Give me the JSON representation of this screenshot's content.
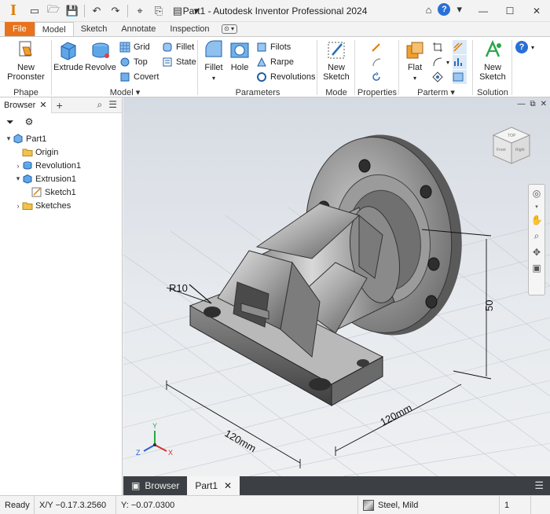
{
  "titlebar": {
    "title": "Part1 - Autodesk Inventor Professional 2024",
    "qat_icons": [
      "new-file-icon",
      "open-icon",
      "save-icon",
      "undo-icon",
      "redo-icon",
      "select-icon",
      "share-icon",
      "measure-icon"
    ]
  },
  "tabs": [
    "File",
    "Model",
    "Sketch",
    "Annotate",
    "Inspection"
  ],
  "ribbon": {
    "phape": {
      "new_label": "New\nProonster",
      "group": "Phape"
    },
    "model": {
      "extrude": "Extrude",
      "revolve": "Revolve",
      "grid": "Grid",
      "top": "Top",
      "covert": "Covert",
      "fillet": "Fillet",
      "state": "State",
      "group": "Model"
    },
    "parameters": {
      "fillet": "Fillet",
      "hole": "Hole",
      "filots": "Filots",
      "rarpe": "Rarpe",
      "revolutions": "Revolutions",
      "group": "Parameters"
    },
    "mode": {
      "new_sketch": "New\nSketch",
      "group": "Mode"
    },
    "properties": {
      "group": "Properties"
    },
    "parterm": {
      "flat": "Flat",
      "group": "Parterm"
    },
    "solution": {
      "new_sketch": "New\nSketch",
      "group": "Solution"
    }
  },
  "browser": {
    "tab_label": "Browser",
    "tree": [
      {
        "label": "Part1",
        "level": 0,
        "toggle": "▾",
        "icon": "part-icon"
      },
      {
        "label": "Origin",
        "level": 1,
        "toggle": "",
        "icon": "folder-icon"
      },
      {
        "label": "Revolution1",
        "level": 1,
        "toggle": "›",
        "icon": "revolution-icon"
      },
      {
        "label": "Extrusion1",
        "level": 1,
        "toggle": "▾",
        "icon": "extrusion-icon"
      },
      {
        "label": "Sketch1",
        "level": 2,
        "toggle": "",
        "icon": "sketch-icon"
      },
      {
        "label": "Sketches",
        "level": 1,
        "toggle": "›",
        "icon": "folder-icon"
      }
    ]
  },
  "viewport": {
    "dim_r10": "R10",
    "dim_120_left": "120mm",
    "dim_120_right": "120mm",
    "dim_50": "50",
    "viewcube": {
      "top": "TOP",
      "front": "Front",
      "right": "Right"
    },
    "axes": {
      "x": "X",
      "y": "Y",
      "z": "Z"
    }
  },
  "doctabs": {
    "browser": "Browser",
    "part": "Part1"
  },
  "status": {
    "ready": "Ready",
    "xy": "X/Y  −0.17.3.2560",
    "y": "Y:  −0.07.0300",
    "material": "Steel, Mild",
    "count": "1"
  }
}
